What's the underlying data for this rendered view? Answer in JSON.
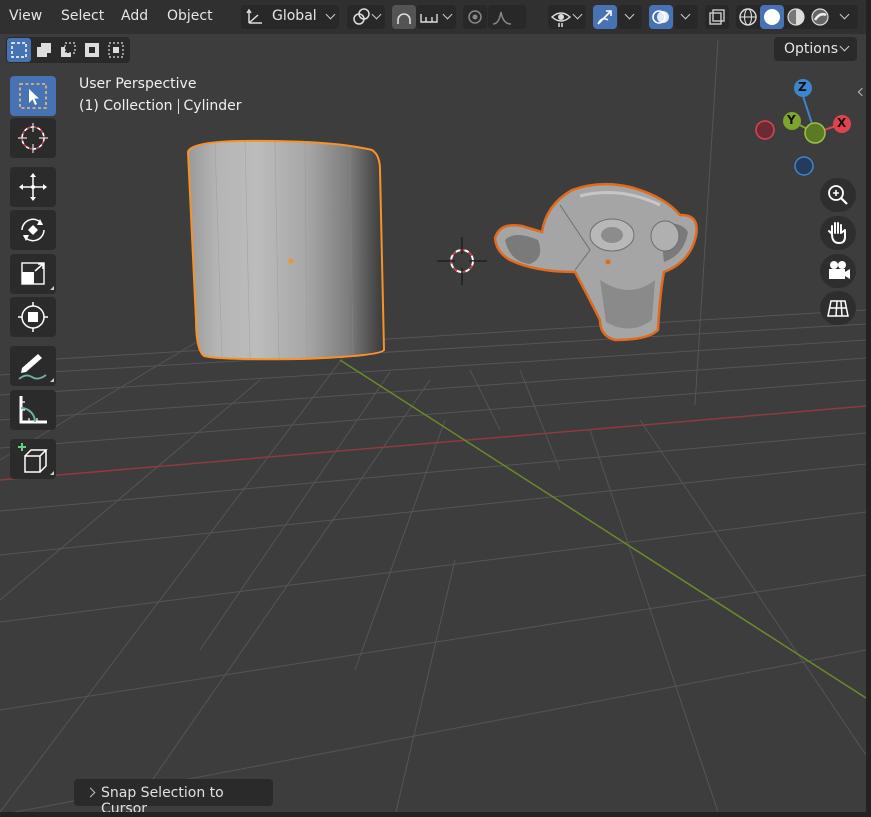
{
  "menu": {
    "view": "View",
    "select": "Select",
    "add": "Add",
    "object": "Object"
  },
  "header": {
    "orientation": "Global",
    "options": "Options"
  },
  "overlay": {
    "perspective": "User Perspective",
    "collection": "(1) Collection",
    "active_object": "Cylinder"
  },
  "gizmo": {
    "z": "Z",
    "y": "Y",
    "x": "X",
    "colors": {
      "x": "#e0434f",
      "y": "#7ea430",
      "z": "#3d86ce"
    }
  },
  "last_operation": "Snap Selection to Cursor",
  "colors": {
    "accent": "#4772b3",
    "selection_outline": "#f5922c",
    "selection_outline_secondary": "#e06a1e",
    "x_axis": "#a7333a",
    "y_axis": "#6a8a2a"
  },
  "icons": {
    "transform_orientation": "orientation-icon",
    "pivot": "pivot-icon",
    "snap": "snap-icon",
    "proportional": "proportional-editing-icon",
    "visibility": "visibility-icon",
    "gizmo_toggle": "gizmo-icon",
    "overlay_toggle": "overlay-icon",
    "xray": "xray-icon"
  }
}
